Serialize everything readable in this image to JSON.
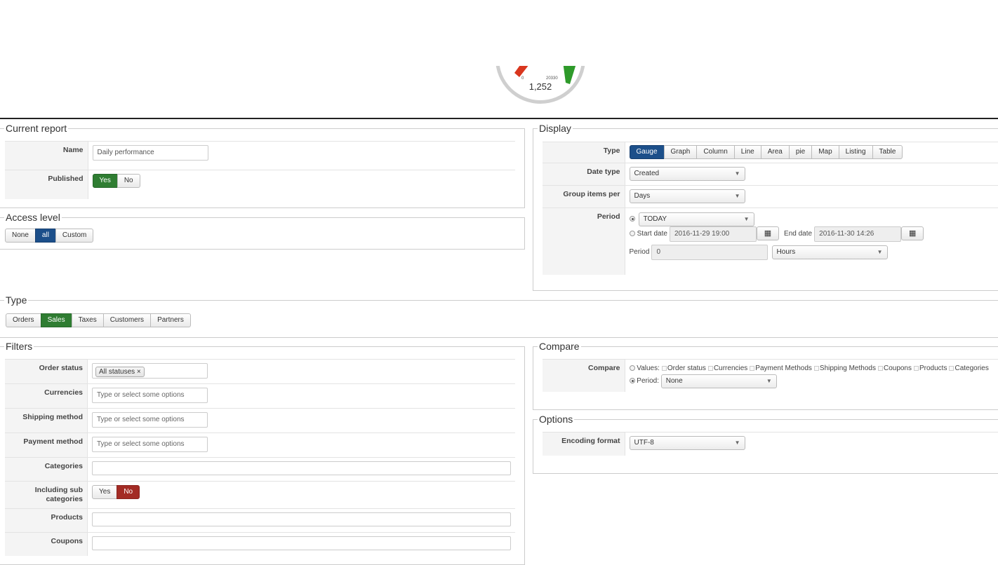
{
  "gauge": {
    "min": "0",
    "max": "20330",
    "value": "1,252",
    "fraction": 0.0616
  },
  "current_report": {
    "legend": "Current report",
    "name_label": "Name",
    "name_value": "Daily performance",
    "published_label": "Published",
    "yes": "Yes",
    "no": "No",
    "published": "Yes"
  },
  "access_level": {
    "legend": "Access level",
    "options": [
      "None",
      "all",
      "Custom"
    ],
    "selected": "all"
  },
  "display": {
    "legend": "Display",
    "type_label": "Type",
    "types": [
      "Gauge",
      "Graph",
      "Column",
      "Line",
      "Area",
      "pie",
      "Map",
      "Listing",
      "Table"
    ],
    "type_selected": "Gauge",
    "date_type_label": "Date type",
    "date_type_value": "Created",
    "group_label": "Group items per",
    "group_value": "Days",
    "period_label": "Period",
    "period_value": "TODAY",
    "start_label": "Start date",
    "start_value": "2016-11-29 19:00",
    "end_label": "End date",
    "end_value": "2016-11-30 14:26",
    "period2_label": "Period",
    "period2_value": "0",
    "period2_unit": "Hours",
    "calendar_icon": "calendar-icon"
  },
  "type_section": {
    "legend": "Type",
    "options": [
      "Orders",
      "Sales",
      "Taxes",
      "Customers",
      "Partners"
    ],
    "selected": "Sales"
  },
  "filters": {
    "legend": "Filters",
    "order_status_label": "Order status",
    "order_status_chip": "All statuses",
    "chip_remove": "×",
    "currencies_label": "Currencies",
    "shipping_label": "Shipping method",
    "payment_label": "Payment method",
    "placeholder": "Type or select some options",
    "categories_label": "Categories",
    "sub_label_1": "Including sub",
    "sub_label_2": "categories",
    "yes": "Yes",
    "no": "No",
    "sub_selected": "No",
    "products_label": "Products",
    "coupons_label": "Coupons"
  },
  "compare": {
    "legend": "Compare",
    "label": "Compare",
    "values_label": "Values:",
    "values": [
      "Order status",
      "Currencies",
      "Payment Methods",
      "Shipping Methods",
      "Coupons",
      "Products",
      "Categories"
    ],
    "period_label": "Period:",
    "period_value": "None"
  },
  "options": {
    "legend": "Options",
    "encoding_label": "Encoding format",
    "encoding_value": "UTF-8"
  },
  "colors": {
    "green": "#2f7d32",
    "blue": "#1c4f8a",
    "red": "#a32b24",
    "gauge_red": "#d9361e",
    "gauge_green": "#2e9a2a"
  }
}
